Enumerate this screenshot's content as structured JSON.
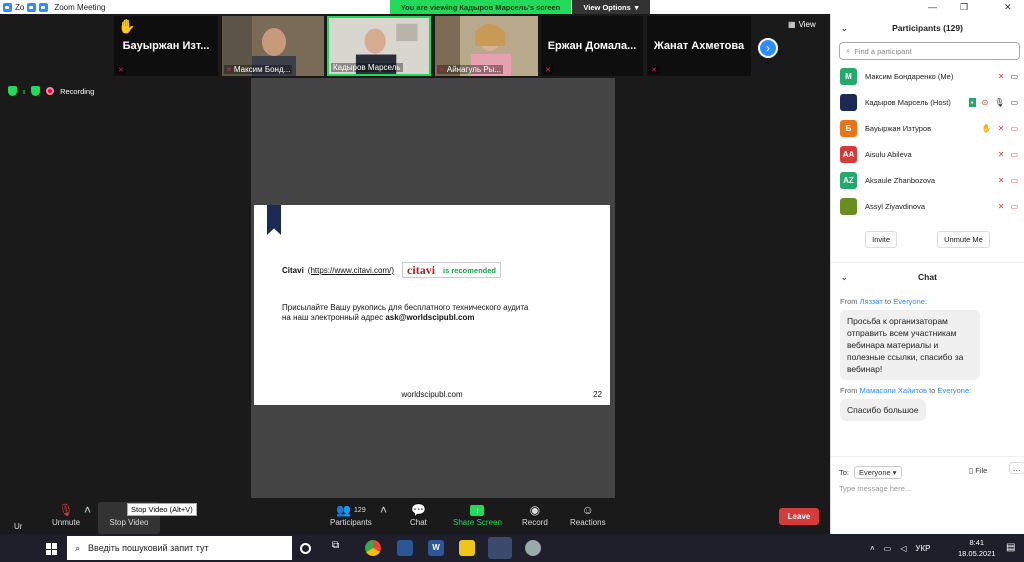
{
  "window": {
    "tab_abbrev": "Zo",
    "title": "Zoom Meeting"
  },
  "banner": {
    "viewing": "You are viewing Кадыров Марсель's screen",
    "view_options": "View Options"
  },
  "strip": {
    "tiles": [
      {
        "name": "Бауыржан Изт...",
        "caption": ""
      },
      {
        "name": "",
        "caption": "Максим Бонд..."
      },
      {
        "name": "",
        "caption": "Кадыров Марсель"
      },
      {
        "name": "",
        "caption": "Айнагуль Ры..."
      },
      {
        "name": "Ержан Домала...",
        "caption": ""
      },
      {
        "name": "Жанат Ахметова",
        "caption": ""
      }
    ],
    "view_label": "View"
  },
  "status": {
    "recording": "Recording"
  },
  "slide": {
    "citavi_label": "Citavi",
    "citavi_url": "(https://www.citavi.com/)",
    "citavi_logo": "citavi",
    "recommended": "is recomended",
    "line_a": "Присылайте Вашу рукопись для бесплатного технического аудита",
    "line_b": "на наш электронный адрес",
    "email": "ask@worldscipubl.com",
    "footer": "worldscipubl.com",
    "page": "22"
  },
  "toolbar": {
    "unmute_partial": "Ur",
    "unmute": "Unmute",
    "stop_video": "Stop Video",
    "tooltip": "Stop Video (Alt+V)",
    "participants_count": "129",
    "participants": "Participants",
    "chat": "Chat",
    "share": "Share Screen",
    "record": "Record",
    "reactions": "Reactions",
    "leave": "Leave"
  },
  "participants": {
    "title": "Participants (129)",
    "search_placeholder": "Find a participant",
    "list": [
      {
        "initials": "M",
        "name": "Максим Бондаренко (Me)",
        "color": "#23a86d"
      },
      {
        "initials": "",
        "name": "Кадыров Марсель (Host)",
        "color": "#1a2a55"
      },
      {
        "initials": "Б",
        "name": "Бауыржан Изтуров",
        "color": "#e8751a"
      },
      {
        "initials": "AA",
        "name": "Aisulu Abileva",
        "color": "#d63b3b"
      },
      {
        "initials": "AZ",
        "name": "Aksaule Zhanbozova",
        "color": "#23a86d"
      },
      {
        "initials": "",
        "name": "Assyl Ziyavdinova",
        "color": "#6b8e23"
      }
    ],
    "invite": "Invite",
    "unmute_me": "Unmute Me"
  },
  "chat": {
    "title": "Chat",
    "from_word": "From",
    "to_word": "to",
    "messages": [
      {
        "sender": "Ляззат",
        "recipient": "Everyone:",
        "text": "Просьба к организаторам отправить всем участникам вебинара материалы и полезные ссылки, спасибо за вебинар!"
      },
      {
        "sender": "Мамасоли Хайитов",
        "recipient": "Everyone:",
        "text": "Спасибо большое"
      }
    ],
    "to_label": "To:",
    "to_value": "Everyone",
    "file": "File",
    "more": "...",
    "input_placeholder": "Type message here..."
  },
  "taskbar": {
    "search": "Введіть пошуковий запит тут",
    "lang": "УКР",
    "time": "8:41",
    "date": "18.05.2021"
  }
}
